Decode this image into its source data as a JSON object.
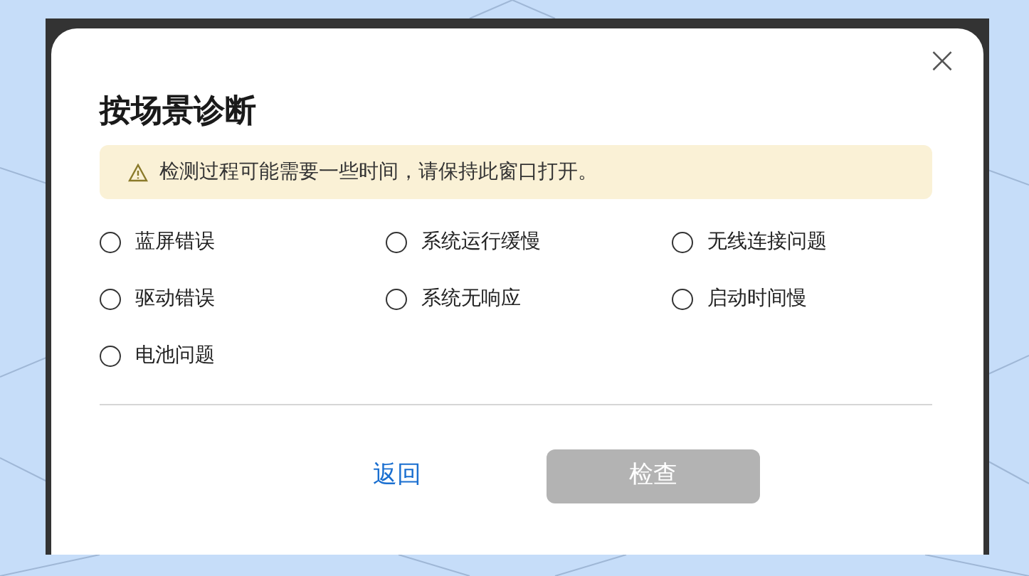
{
  "dialog": {
    "title": "按场景诊断",
    "close_symbol": "×",
    "notice": {
      "text": "检测过程可能需要一些时间，请保持此窗口打开。"
    },
    "options": [
      {
        "label": "蓝屏错误",
        "selected": false
      },
      {
        "label": "系统运行缓慢",
        "selected": false
      },
      {
        "label": "无线连接问题",
        "selected": false
      },
      {
        "label": "驱动错误",
        "selected": false
      },
      {
        "label": "系统无响应",
        "selected": false
      },
      {
        "label": "启动时间慢",
        "selected": false
      },
      {
        "label": "电池问题",
        "selected": false
      }
    ],
    "back_link": "返回",
    "check_button": {
      "label": "检查",
      "disabled": true
    }
  }
}
